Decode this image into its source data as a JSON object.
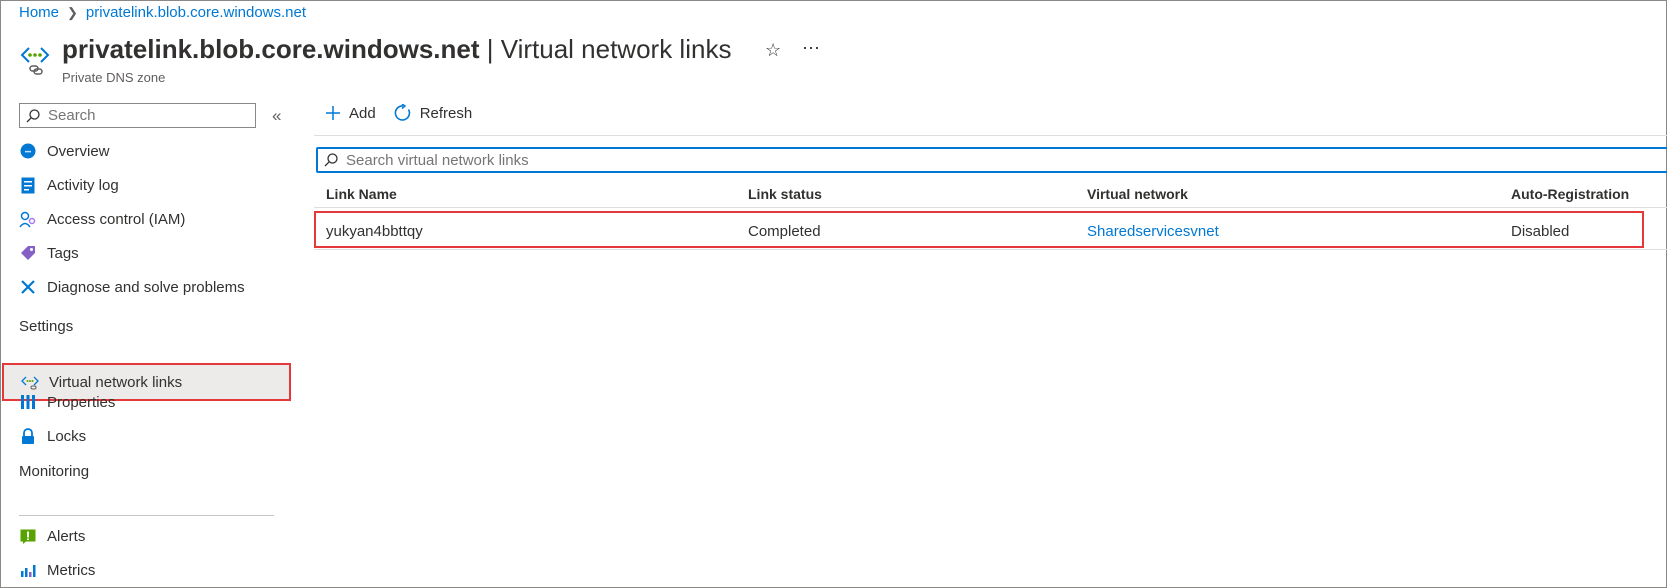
{
  "breadcrumb": {
    "home": "Home",
    "current": "privatelink.blob.core.windows.net"
  },
  "header": {
    "resource_name": "privatelink.blob.core.windows.net",
    "page_title": " | Virtual network links",
    "subtitle": "Private DNS zone",
    "favorite_icon": "star-icon",
    "more_icon": "ellipsis-icon"
  },
  "sidebar": {
    "search_placeholder": "Search",
    "collapse_icon": "double-chevron-left-icon",
    "top_items": [
      {
        "label": "Overview",
        "icon": "overview-icon"
      },
      {
        "label": "Activity log",
        "icon": "activity-log-icon"
      },
      {
        "label": "Access control (IAM)",
        "icon": "iam-icon"
      },
      {
        "label": "Tags",
        "icon": "tag-icon"
      },
      {
        "label": "Diagnose and solve problems",
        "icon": "wrench-icon"
      }
    ],
    "settings_heading": "Settings",
    "settings_items": [
      {
        "label": "Virtual network links",
        "icon": "vnet-link-icon",
        "selected": true
      },
      {
        "label": "Properties",
        "icon": "properties-icon"
      },
      {
        "label": "Locks",
        "icon": "lock-icon"
      }
    ],
    "monitoring_heading": "Monitoring",
    "monitoring_items": [
      {
        "label": "Alerts",
        "icon": "alert-icon"
      },
      {
        "label": "Metrics",
        "icon": "metrics-icon"
      }
    ]
  },
  "toolbar": {
    "add_label": "Add",
    "refresh_label": "Refresh"
  },
  "table": {
    "search_placeholder": "Search virtual network links",
    "columns": [
      "Link Name",
      "Link status",
      "Virtual network",
      "Auto-Registration"
    ],
    "rows": [
      {
        "link_name": "yukyan4bbttqy",
        "link_status": "Completed",
        "virtual_network": "Sharedservicesvnet",
        "auto_registration": "Disabled"
      }
    ]
  },
  "colors": {
    "accent": "#0078d4",
    "highlight": "#e5383b",
    "selected_bg": "#edebe9"
  }
}
